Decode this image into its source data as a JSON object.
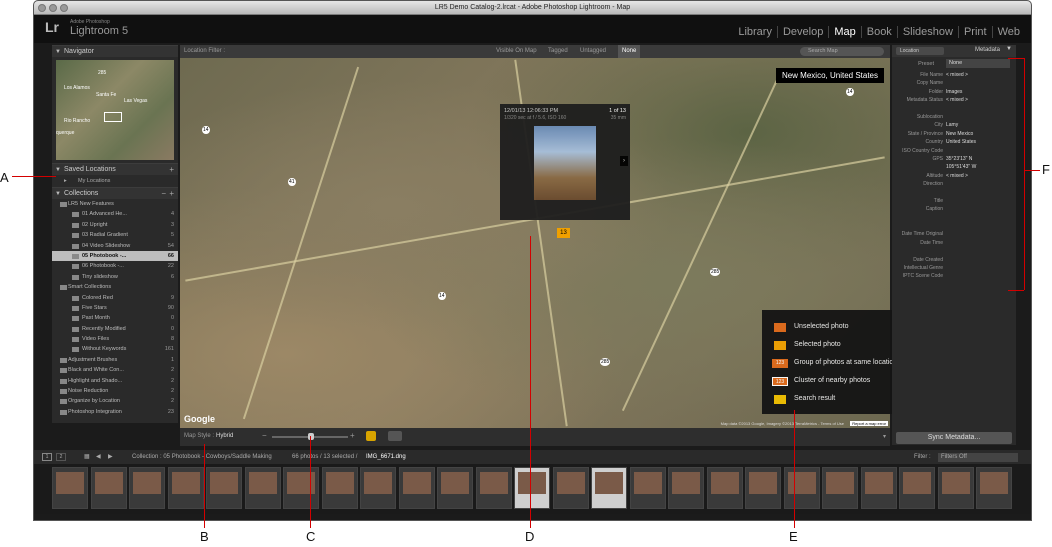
{
  "window": {
    "title": "LR5 Demo Catalog-2.lrcat - Adobe Photoshop Lightroom - Map"
  },
  "branding": {
    "logo": "Lr",
    "subtitle": "Adobe Photoshop",
    "product": "Lightroom 5"
  },
  "modules": [
    "Library",
    "Develop",
    "Map",
    "Book",
    "Slideshow",
    "Print",
    "Web"
  ],
  "active_module": "Map",
  "navigator": {
    "header": "Navigator",
    "places": [
      "Los Alamos",
      "Santa Fe",
      "Las Vegas",
      "Rio Rancho",
      "querque"
    ]
  },
  "saved_locations": {
    "header": "Saved Locations",
    "item": "My Locations"
  },
  "collections": {
    "header": "Collections",
    "rows": [
      {
        "label": "LR5 New Features",
        "count": "",
        "level": 1
      },
      {
        "label": "01 Advanced He...",
        "count": "4",
        "level": 2
      },
      {
        "label": "02 Upright",
        "count": "3",
        "level": 2
      },
      {
        "label": "03 Radial Gradient",
        "count": "5",
        "level": 2
      },
      {
        "label": "04 Video Slideshow",
        "count": "54",
        "level": 2
      },
      {
        "label": "05 Photobook -...",
        "count": "66",
        "level": 2,
        "selected": true
      },
      {
        "label": "06 Photobook -...",
        "count": "22",
        "level": 2
      },
      {
        "label": "Tiny slideshow",
        "count": "6",
        "level": 2
      },
      {
        "label": "Smart Collections",
        "count": "",
        "level": 1
      },
      {
        "label": "Colored Red",
        "count": "9",
        "level": 2
      },
      {
        "label": "Five Stars",
        "count": "90",
        "level": 2
      },
      {
        "label": "Past Month",
        "count": "0",
        "level": 2
      },
      {
        "label": "Recently Modified",
        "count": "0",
        "level": 2
      },
      {
        "label": "Video Files",
        "count": "8",
        "level": 2
      },
      {
        "label": "Without Keywords",
        "count": "161",
        "level": 2
      },
      {
        "label": "Adjustment Brushes",
        "count": "1",
        "level": 1
      },
      {
        "label": "Black and White Con...",
        "count": "2",
        "level": 1
      },
      {
        "label": "Highlight and Shado...",
        "count": "2",
        "level": 1
      },
      {
        "label": "Noise Reduction",
        "count": "2",
        "level": 1
      },
      {
        "label": "Organize by Location",
        "count": "2",
        "level": 1
      },
      {
        "label": "Photoshop Integration",
        "count": "23",
        "level": 1
      }
    ]
  },
  "location_filter": {
    "label": "Location Filter :",
    "options": [
      "Visible On Map",
      "Tagged",
      "Untagged",
      "None"
    ],
    "active": "None",
    "search_placeholder": "Search Map"
  },
  "map": {
    "location_label": "New Mexico, United States",
    "google": "Google",
    "credits": "Map data ©2013 Google, Imagery ©2013 TerraMetrics - Terms of Use",
    "report": "Report a map error",
    "pin_count": "13",
    "numbers": [
      "285",
      "285",
      "285",
      "285",
      "41",
      "14",
      "14",
      "41",
      "41",
      "41",
      "41",
      "14"
    ]
  },
  "popup": {
    "date": "12/01/13 12:06:33 PM",
    "counter": "1 of 13",
    "exposure": "1/320 sec at f / 5.6, ISO 160",
    "focal": "35 mm"
  },
  "legend": {
    "items": [
      "Unselected photo",
      "Selected photo",
      "Group of photos at same location",
      "Cluster of nearby photos",
      "Search result"
    ],
    "badge": "123"
  },
  "map_toolbar": {
    "label": "Map Style :",
    "style": "Hybrid"
  },
  "right_panel": {
    "location_tab": "Location",
    "metadata_tab": "Metadata",
    "preset_label": "Preset",
    "preset_value": "None",
    "fields": [
      {
        "k": "File Name",
        "v": "< mixed >"
      },
      {
        "k": "Copy Name",
        "v": ""
      },
      {
        "k": "Folder",
        "v": "Images"
      },
      {
        "k": "Metadata Status",
        "v": "< mixed >"
      },
      {
        "k": "",
        "v": ""
      },
      {
        "k": "Sublocation",
        "v": ""
      },
      {
        "k": "City",
        "v": "Lamy"
      },
      {
        "k": "State / Province",
        "v": "New Mexico"
      },
      {
        "k": "Country",
        "v": "United States"
      },
      {
        "k": "ISO Country Code",
        "v": ""
      },
      {
        "k": "GPS",
        "v": "35°23'13\" N"
      },
      {
        "k": "",
        "v": "105°51'43\" W"
      },
      {
        "k": "Altitude",
        "v": "< mixed >"
      },
      {
        "k": "Direction",
        "v": ""
      },
      {
        "k": "",
        "v": ""
      },
      {
        "k": "Title",
        "v": ""
      },
      {
        "k": "Caption",
        "v": ""
      },
      {
        "k": "",
        "v": ""
      },
      {
        "k": "",
        "v": ""
      },
      {
        "k": "Date Time Original",
        "v": ""
      },
      {
        "k": "Date Time",
        "v": ""
      },
      {
        "k": "",
        "v": ""
      },
      {
        "k": "Date Created",
        "v": ""
      },
      {
        "k": "Intellectual Genre",
        "v": ""
      },
      {
        "k": "IPTC Scene Code",
        "v": ""
      }
    ],
    "sync_button": "Sync Metadata..."
  },
  "filmstrip_bar": {
    "screen1": "1",
    "screen2": "2",
    "collection": "Collection : 05 Photobook - Cowboys/Saddle Making",
    "count": "66 photos / 13 selected /",
    "file": "IMG_6671.dng",
    "filter_label": "Filter :",
    "filter_value": "Filters Off"
  },
  "callouts": [
    "A",
    "B",
    "C",
    "D",
    "E",
    "F"
  ]
}
